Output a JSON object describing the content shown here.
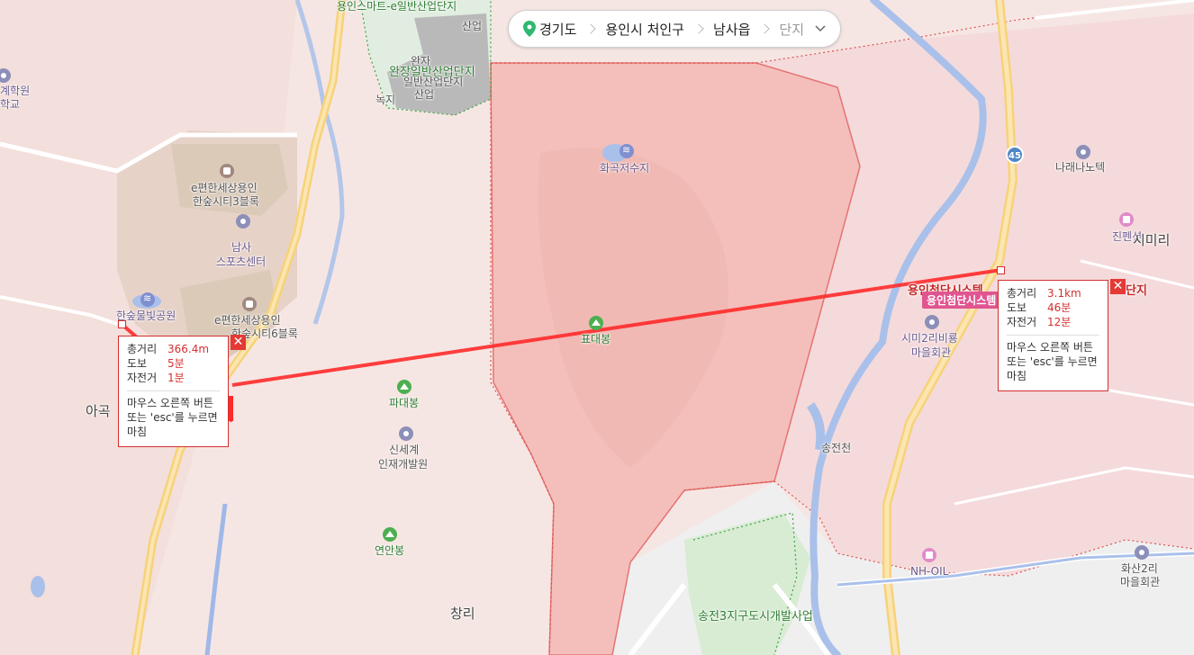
{
  "breadcrumb": {
    "items": [
      "경기도",
      "용인시 처인구",
      "남사읍"
    ],
    "dropdown": "단지"
  },
  "labels": {
    "yongin_smart": "용인스마트-e일반산업단지",
    "sanup_top": "산업",
    "wanjang": "완장일반산업단지",
    "wanjang2": "일반산업단지",
    "wanja": "완자",
    "sanup2": "산업",
    "nokji": "녹지",
    "hwagok_reservoir": "화곡저수지",
    "hakwon": "계학원",
    "hakgyo": "학교",
    "epyeonhan_3": "e편한세상용인",
    "epyeonhan_3b": "한숲시티3블록",
    "namsa_sports": "남사",
    "namsa_sports2": "스포츠센터",
    "hansup_park": "한숲물빛공원",
    "epyeonhan_6": "e편한세상용인",
    "epyeonhan_6b": "한숲시티6블록",
    "agok": "아곡",
    "pyodaebong": "표대봉",
    "padaebong": "파대봉",
    "shinsegae": "신세계",
    "shinsegae2": "인재개발원",
    "yeonanbong": "연안봉",
    "changri": "창리",
    "songjeon3": "송전3지구도시개발사업",
    "nanenano": "나래나노텍",
    "jinpension": "진펜션",
    "simiri": "시미리",
    "yongin_cheomdan": "용인첨단시스템",
    "danji": "단지",
    "yongin_prefix": "용인첨단시스템",
    "simi2": "시미2리비룡",
    "simi2b": "마을회관",
    "songjeoncheon": "송전천",
    "nhoil": "NH-OIL",
    "hwasan": "화산2리",
    "hwasan2": "마을회관",
    "route_45": "45"
  },
  "measure_left": {
    "total_label": "총거리",
    "total_value": "366.4m",
    "walk_label": "도보",
    "walk_value": "5분",
    "bike_label": "자전거",
    "bike_value": "1분",
    "hint": "마우스 오른쪽 버튼 또는 'esc'를 누르면 마침"
  },
  "measure_right": {
    "total_label": "총거리",
    "total_value": "3.1km",
    "walk_label": "도보",
    "walk_value": "46분",
    "bike_label": "자전거",
    "bike_value": "12분",
    "hint": "마우스 오른쪽 버튼 또는 'esc'를 누르면 마침"
  },
  "colors": {
    "region_fill": "#f7c6c2",
    "region_border": "#e57373",
    "measure_line": "#ff2a2a",
    "road": "#f7d27a",
    "river": "#9fb8e8",
    "park": "#c8e6c9"
  }
}
